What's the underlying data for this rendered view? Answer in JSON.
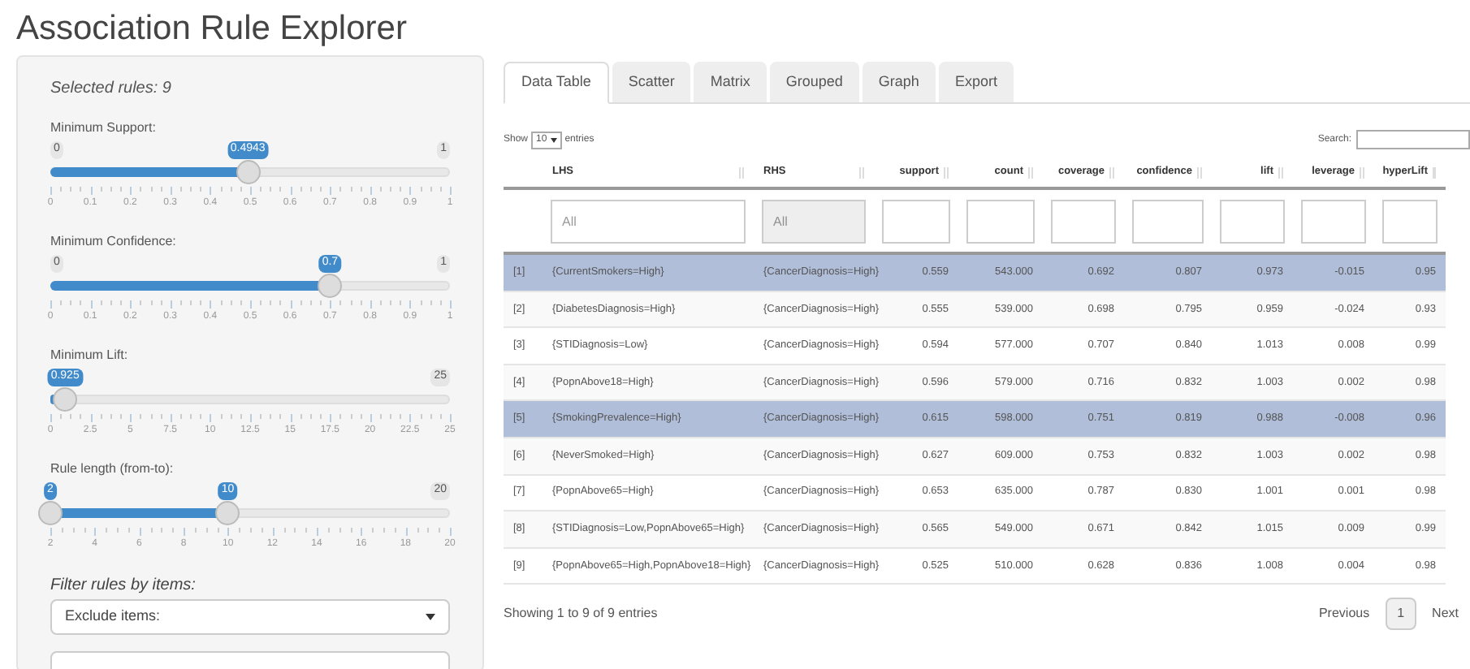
{
  "title": "Association Rule Explorer",
  "sidebar": {
    "selected_rules": "Selected rules: 9",
    "sliders": [
      {
        "kind": "single",
        "label": "Minimum Support:",
        "min": "0",
        "max": "1",
        "value": "0.4943",
        "level": 0.4943,
        "ticks": [
          "0",
          "0.1",
          "0.2",
          "0.3",
          "0.4",
          "0.5",
          "0.6",
          "0.7",
          "0.8",
          "0.9",
          "1"
        ]
      },
      {
        "kind": "single",
        "label": "Minimum Confidence:",
        "min": "0",
        "max": "1",
        "value": "0.7",
        "level": 0.7,
        "ticks": [
          "0",
          "0.1",
          "0.2",
          "0.3",
          "0.4",
          "0.5",
          "0.6",
          "0.7",
          "0.8",
          "0.9",
          "1"
        ]
      },
      {
        "kind": "single",
        "label": "Minimum Lift:",
        "max": "25",
        "value": "0.925",
        "level": 0.037,
        "ticks": [
          "0",
          "2.5",
          "5",
          "7.5",
          "10",
          "12.5",
          "15",
          "17.5",
          "20",
          "22.5",
          "25"
        ]
      },
      {
        "kind": "range",
        "label": "Rule length (from-to):",
        "max": "20",
        "from": {
          "value": "2",
          "level": 0
        },
        "to": {
          "value": "10",
          "level": 0.444
        },
        "ticks": [
          "2",
          "4",
          "6",
          "8",
          "10",
          "12",
          "14",
          "16",
          "18",
          "20"
        ]
      }
    ],
    "filter_label": "Filter rules by items:",
    "filter_select": "Exclude items:"
  },
  "tabs": [
    {
      "label": "Data Table",
      "selected": true
    },
    {
      "label": "Scatter",
      "selected": false
    },
    {
      "label": "Matrix",
      "selected": false
    },
    {
      "label": "Grouped",
      "selected": false
    },
    {
      "label": "Graph",
      "selected": false
    },
    {
      "label": "Export",
      "selected": false
    }
  ],
  "table": {
    "show_label": "Show",
    "page_size": "10",
    "entries_label": "entries",
    "search_label": "Search:",
    "columns": [
      "LHS",
      "RHS",
      "support",
      "count",
      "coverage",
      "confidence",
      "lift",
      "leverage",
      "hyperLift"
    ],
    "filters": [
      {
        "placeholder": "All",
        "disabled": false
      },
      {
        "placeholder": "All",
        "disabled": true
      }
    ],
    "rows": [
      {
        "index": "[1]",
        "cells": [
          "{CurrentSmokers=High}",
          "{CancerDiagnosis=High}",
          "0.559",
          "543.000",
          "0.692",
          "0.807",
          "0.973",
          "-0.015",
          "0.95"
        ],
        "selected": true
      },
      {
        "index": "[2]",
        "cells": [
          "{DiabetesDiagnosis=High}",
          "{CancerDiagnosis=High}",
          "0.555",
          "539.000",
          "0.698",
          "0.795",
          "0.959",
          "-0.024",
          "0.93"
        ],
        "selected": false
      },
      {
        "index": "[3]",
        "cells": [
          "{STIDiagnosis=Low}",
          "{CancerDiagnosis=High}",
          "0.594",
          "577.000",
          "0.707",
          "0.840",
          "1.013",
          "0.008",
          "0.99"
        ],
        "selected": false
      },
      {
        "index": "[4]",
        "cells": [
          "{PopnAbove18=High}",
          "{CancerDiagnosis=High}",
          "0.596",
          "579.000",
          "0.716",
          "0.832",
          "1.003",
          "0.002",
          "0.98"
        ],
        "selected": false
      },
      {
        "index": "[5]",
        "cells": [
          "{SmokingPrevalence=High}",
          "{CancerDiagnosis=High}",
          "0.615",
          "598.000",
          "0.751",
          "0.819",
          "0.988",
          "-0.008",
          "0.96"
        ],
        "selected": true
      },
      {
        "index": "[6]",
        "cells": [
          "{NeverSmoked=High}",
          "{CancerDiagnosis=High}",
          "0.627",
          "609.000",
          "0.753",
          "0.832",
          "1.003",
          "0.002",
          "0.98"
        ],
        "selected": false
      },
      {
        "index": "[7]",
        "cells": [
          "{PopnAbove65=High}",
          "{CancerDiagnosis=High}",
          "0.653",
          "635.000",
          "0.787",
          "0.830",
          "1.001",
          "0.001",
          "0.98"
        ],
        "selected": false
      },
      {
        "index": "[8]",
        "cells": [
          "{STIDiagnosis=Low,PopnAbove65=High}",
          "{CancerDiagnosis=High}",
          "0.565",
          "549.000",
          "0.671",
          "0.842",
          "1.015",
          "0.009",
          "0.99"
        ],
        "selected": false
      },
      {
        "index": "[9]",
        "cells": [
          "{PopnAbove65=High,PopnAbove18=High}",
          "{CancerDiagnosis=High}",
          "0.525",
          "510.000",
          "0.628",
          "0.836",
          "1.008",
          "0.004",
          "0.98"
        ],
        "selected": false
      }
    ],
    "info": "Showing 1 to 9 of 9 entries",
    "pagination": [
      {
        "label": "Previous",
        "selected": false
      },
      {
        "label": "1",
        "selected": true
      },
      {
        "label": "Next",
        "selected": false
      }
    ]
  }
}
